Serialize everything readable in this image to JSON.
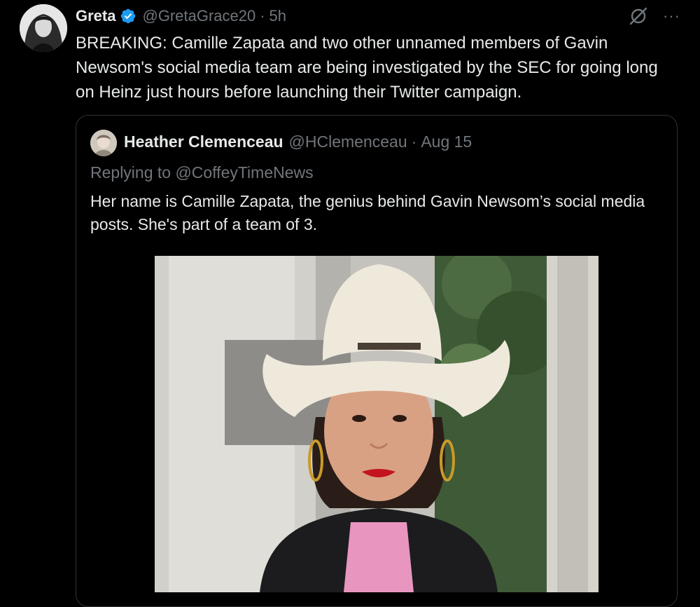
{
  "tweet": {
    "name": "Greta",
    "handle": "@GretaGrace20",
    "separator": "·",
    "time": "5h",
    "more_label": "···",
    "text": "BREAKING: Camille Zapata and two other unnamed members of Gavin Newsom's social media team are being investigated by the SEC for going long on Heinz just hours before launching their Twitter campaign."
  },
  "quote": {
    "name": "Heather Clemenceau",
    "handle": "@HClemenceau",
    "separator": "·",
    "date": "Aug 15",
    "replying_to": "Replying to @CoffeyTimeNews",
    "text": "Her name is Camille Zapata, the genius behind Gavin Newsom’s social media posts. She's part of a team of 3."
  },
  "colors": {
    "background": "#000000",
    "text": "#e7e9ea",
    "secondary": "#71767b",
    "verified": "#1d9bf0",
    "border": "#2f3336"
  },
  "icons": {
    "verified": "verified-badge-icon",
    "grok": "grok-icon",
    "more": "more-icon"
  }
}
